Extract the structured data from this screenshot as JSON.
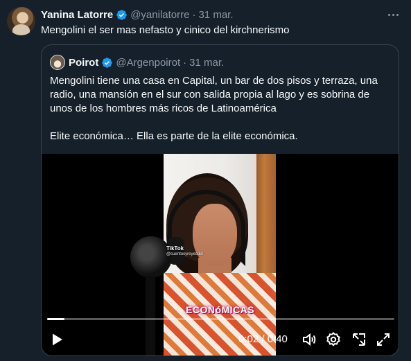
{
  "tweet": {
    "author_name": "Yanina Latorre",
    "author_handle": "@yanilatorre",
    "separator": "·",
    "date": "31 mar.",
    "text": "Mengolini el ser mas nefasto y cinico del kirchnerismo"
  },
  "quote": {
    "author_name": "Poirot",
    "author_handle": "@Argenpoirot",
    "separator": "·",
    "date": "31 mar.",
    "paragraph1": "Mengolini tiene una casa en Capital, un bar de dos pisos y terraza, una radio, una mansión en el sur con salida propia al lago y es sobrina de unos de los hombres más ricos de Latinoamérica",
    "paragraph2": "Elite económica… Ella es parte de la elite económica."
  },
  "video": {
    "watermark": "TikTok",
    "watermark_handle": "@cuentosyreyesdel",
    "caption": "ECONóMICAS",
    "time": "0:02 / 0:40",
    "progress": 0.05
  },
  "colors": {
    "background": "#15202b",
    "text": "#f7f9f9",
    "muted": "#8b98a5",
    "verified": "#1d9bf0",
    "border": "#38444d"
  },
  "icons": [
    "verified-badge-icon",
    "more-options-icon",
    "play-icon",
    "volume-icon",
    "settings-icon",
    "popout-icon",
    "fullscreen-icon"
  ]
}
